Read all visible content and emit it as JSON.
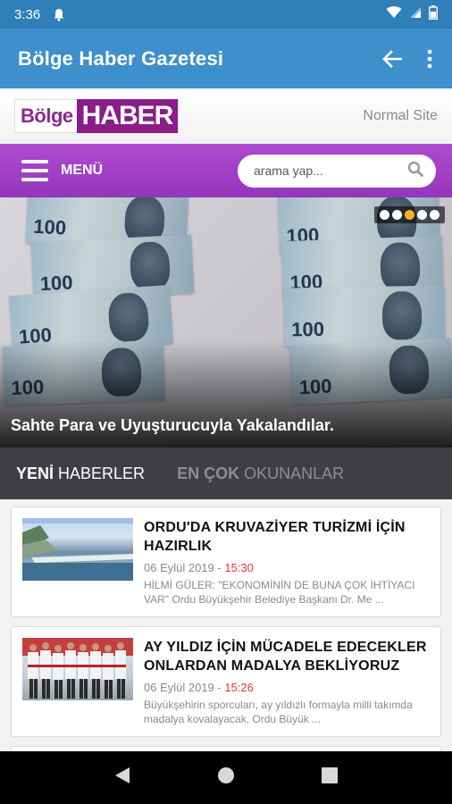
{
  "status_bar": {
    "time": "3:36",
    "icons": [
      "notification-bell-icon",
      "wifi-icon",
      "signal-icon",
      "battery-icon"
    ]
  },
  "app_bar": {
    "title": "Bölge Haber Gazetesi",
    "icons": [
      "back-arrow-icon",
      "more-vert-icon"
    ]
  },
  "site_header": {
    "logo_part1": "Bölge",
    "logo_part2": "HABER",
    "normal_site": "Normal Site"
  },
  "menu_bar": {
    "menu_label": "MENÜ",
    "search_placeholder": "arama yap..."
  },
  "slider": {
    "caption": "Sahte Para ve Uyuşturucuyla Yakalandılar.",
    "note_labels": [
      "100",
      "100",
      "100",
      "100",
      "100",
      "100",
      "100",
      "100"
    ],
    "dot_count": 5,
    "active_dot": 3
  },
  "tabs": [
    {
      "bold": "YENİ",
      "rest": " HABERLER",
      "active": true
    },
    {
      "bold": "EN ÇOK",
      "rest": " OKUNANLAR",
      "active": false
    }
  ],
  "news": [
    {
      "headline": "ORDU'DA KRUVAZİYER TURİZMİ İÇİN HAZIRLIK",
      "date": "06 Eylül 2019 - ",
      "time": "15:30",
      "summary": "HİLMİ GÜLER: \"EKONOMİNİN DE BUNA ÇOK İHTİYACI VAR\" Ordu Büyükşehir Belediye Başkanı Dr. Me ..."
    },
    {
      "headline": "AY YILDIZ İÇİN MÜCADELE EDECEKLER ONLARDAN MADALYA BEKLİYORUZ",
      "date": "06 Eylül 2019 - ",
      "time": "15:26",
      "summary": "Büyükşehirin sporcuları, ay yıldızlı formayla milli takımda madalya kovalayacak. Ordu Büyük ..."
    }
  ],
  "colors": {
    "status_bar": "#2f7fb8",
    "app_bar": "#3f8fcd",
    "menu_bar": "#a542c8",
    "tabs_bg": "#3d3f44",
    "time_accent": "#e03a2d",
    "active_dot": "#f2b21b"
  }
}
